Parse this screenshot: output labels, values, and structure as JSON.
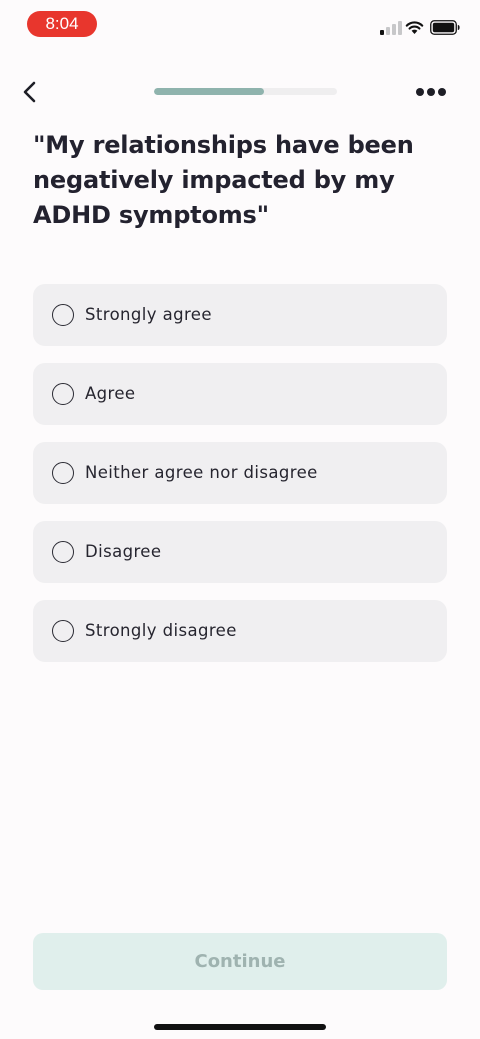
{
  "status_bar": {
    "time": "8:04",
    "time_pill_color": "#e8362d",
    "icons": [
      "signal-icon",
      "wifi-icon",
      "battery-icon"
    ]
  },
  "nav": {
    "back_icon": "chevron-left-icon",
    "more_icon": "more-horizontal-icon",
    "progress": 0.6
  },
  "question": "\"My relationships have been negatively impacted by my ADHD symptoms\"",
  "options": [
    {
      "label": "Strongly agree",
      "selected": false
    },
    {
      "label": "Agree",
      "selected": false
    },
    {
      "label": "Neither agree nor disagree",
      "selected": false
    },
    {
      "label": "Disagree",
      "selected": false
    },
    {
      "label": "Strongly disagree",
      "selected": false
    }
  ],
  "continue_label": "Continue",
  "colors": {
    "accent": "#8fb3ad",
    "continue_bg": "#e0efec",
    "continue_text": "#9fb3b0",
    "option_bg": "#f0eff1"
  }
}
